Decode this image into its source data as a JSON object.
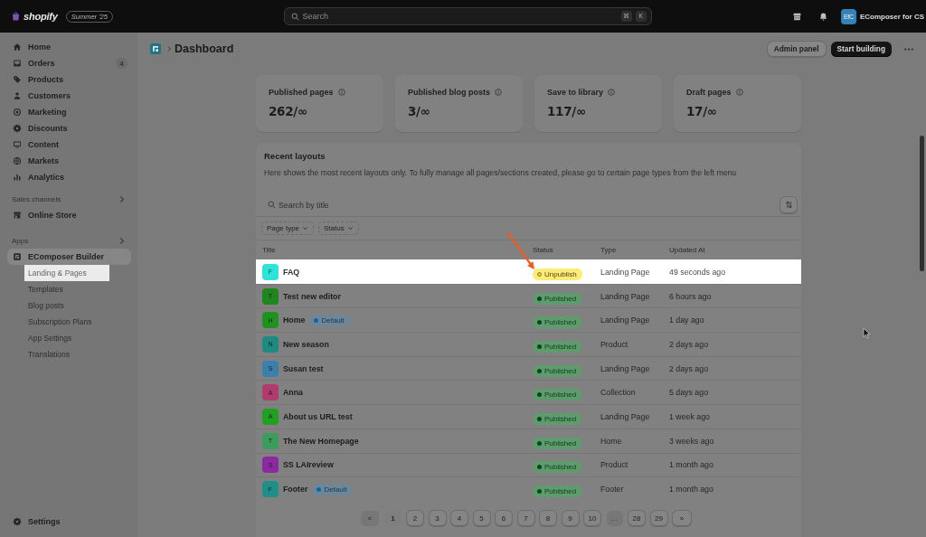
{
  "top_bar": {
    "logo": "shopify",
    "edition": "Summer '25",
    "search": {
      "placeholder": "Search",
      "shortcut_keys": [
        "⌘",
        "K"
      ]
    },
    "account": {
      "initials": "EfC",
      "name": "EComposer for CS"
    }
  },
  "sidebar": {
    "items": [
      {
        "label": "Home",
        "selected": false
      },
      {
        "label": "Orders",
        "badge": "4",
        "selected": false
      },
      {
        "label": "Products",
        "selected": false
      },
      {
        "label": "Customers",
        "selected": false
      },
      {
        "label": "Marketing",
        "selected": false
      },
      {
        "label": "Discounts",
        "selected": false
      },
      {
        "label": "Content",
        "selected": false
      },
      {
        "label": "Markets",
        "selected": false
      },
      {
        "label": "Analytics",
        "selected": false
      }
    ],
    "sections": [
      {
        "title": "Sales channels",
        "items": [
          {
            "label": "Online Store",
            "selected": false
          }
        ]
      },
      {
        "title": "Apps",
        "items": [
          {
            "label": "EComposer Builder",
            "selected": true,
            "children": [
              {
                "label": "Landing & Pages",
                "selected": false,
                "highlighted": true
              },
              {
                "label": "Templates",
                "selected": false,
                "highlighted": false
              },
              {
                "label": "Blog posts",
                "selected": false,
                "highlighted": false
              },
              {
                "label": "Subscription Plans",
                "selected": false,
                "highlighted": false
              },
              {
                "label": "App Settings",
                "selected": false,
                "highlighted": false
              },
              {
                "label": "Translations",
                "selected": false,
                "highlighted": false
              }
            ]
          }
        ]
      }
    ],
    "footer_item": {
      "label": "Settings"
    }
  },
  "header": {
    "title": "Dashboard",
    "buttons": [
      {
        "label": "Admin panel",
        "kind": "secondary"
      },
      {
        "label": "Start building",
        "kind": "primary"
      }
    ]
  },
  "stats": [
    {
      "label": "Published pages",
      "value": "262/∞"
    },
    {
      "label": "Published blog posts",
      "value": "3/∞"
    },
    {
      "label": "Save to library",
      "value": "117/∞"
    },
    {
      "label": "Draft pages",
      "value": "17/∞"
    }
  ],
  "recent_layouts": {
    "title": "Recent layouts",
    "description": "Here shows the most recent layouts only. To fully manage all pages/sections created, please go to certain page types from the left menu",
    "search": {
      "placeholder": "Search by title"
    },
    "filters": [
      "Page type",
      "Status"
    ],
    "table": {
      "columns": [
        "Title",
        "Status",
        "Type",
        "Updated At"
      ],
      "rows": [
        {
          "avatar": {
            "letter": "F",
            "color": "#2ee3d8"
          },
          "title": "FAQ",
          "status": {
            "label": "Unpublish",
            "kind": "attention"
          },
          "type": "Landing Page",
          "updated": "49 seconds ago",
          "highlighted": true
        },
        {
          "avatar": {
            "letter": "T",
            "color": "#1f851f"
          },
          "title": "Test new editor",
          "status": {
            "label": "Published",
            "kind": "success"
          },
          "type": "Landing Page",
          "updated": "6 hours ago",
          "highlighted": false
        },
        {
          "avatar": {
            "letter": "H",
            "color": "#1f921f"
          },
          "title": "Home",
          "badge": "Default",
          "status": {
            "label": "Published",
            "kind": "success"
          },
          "type": "Landing Page",
          "updated": "1 day ago",
          "highlighted": false
        },
        {
          "avatar": {
            "letter": "N",
            "color": "#1f8a80"
          },
          "title": "New season",
          "status": {
            "label": "Published",
            "kind": "success"
          },
          "type": "Product",
          "updated": "2 days ago",
          "highlighted": false
        },
        {
          "avatar": {
            "letter": "S",
            "color": "#3b7fad"
          },
          "title": "Susan test",
          "status": {
            "label": "Published",
            "kind": "success"
          },
          "type": "Landing Page",
          "updated": "2 days ago",
          "highlighted": false
        },
        {
          "avatar": {
            "letter": "A",
            "color": "#b03b6c"
          },
          "title": "Anna",
          "status": {
            "label": "Published",
            "kind": "success"
          },
          "type": "Collection",
          "updated": "5 days ago",
          "highlighted": false
        },
        {
          "avatar": {
            "letter": "A",
            "color": "#21a021"
          },
          "title": "About us URL test",
          "status": {
            "label": "Published",
            "kind": "success"
          },
          "type": "Landing Page",
          "updated": "1 week ago",
          "highlighted": false
        },
        {
          "avatar": {
            "letter": "T",
            "color": "#3b9c5c"
          },
          "title": "The New Homepage",
          "status": {
            "label": "Published",
            "kind": "success"
          },
          "type": "Home",
          "updated": "3 weeks ago",
          "highlighted": false
        },
        {
          "avatar": {
            "letter": "S",
            "color": "#8b2aa0"
          },
          "title": "SS LAIreview",
          "status": {
            "label": "Published",
            "kind": "success"
          },
          "type": "Product",
          "updated": "1 month ago",
          "highlighted": false
        },
        {
          "avatar": {
            "letter": "F",
            "color": "#1f8f88"
          },
          "title": "Footer",
          "badge": "Default",
          "status": {
            "label": "Published",
            "kind": "success"
          },
          "type": "Footer",
          "updated": "1 month ago",
          "highlighted": false
        }
      ]
    },
    "pagination": [
      {
        "label": "«",
        "selected": false,
        "disabled": true
      },
      {
        "label": "1",
        "selected": true,
        "disabled": false
      },
      {
        "label": "2",
        "selected": false,
        "disabled": false
      },
      {
        "label": "3",
        "selected": false,
        "disabled": false
      },
      {
        "label": "4",
        "selected": false,
        "disabled": false
      },
      {
        "label": "5",
        "selected": false,
        "disabled": false
      },
      {
        "label": "6",
        "selected": false,
        "disabled": false
      },
      {
        "label": "7",
        "selected": false,
        "disabled": false
      },
      {
        "label": "8",
        "selected": false,
        "disabled": false
      },
      {
        "label": "9",
        "selected": false,
        "disabled": false
      },
      {
        "label": "10",
        "selected": false,
        "disabled": false
      },
      {
        "label": "…",
        "selected": false,
        "disabled": true
      },
      {
        "label": "28",
        "selected": false,
        "disabled": false
      },
      {
        "label": "29",
        "selected": false,
        "disabled": false
      },
      {
        "label": "»",
        "selected": false,
        "disabled": false
      }
    ]
  }
}
